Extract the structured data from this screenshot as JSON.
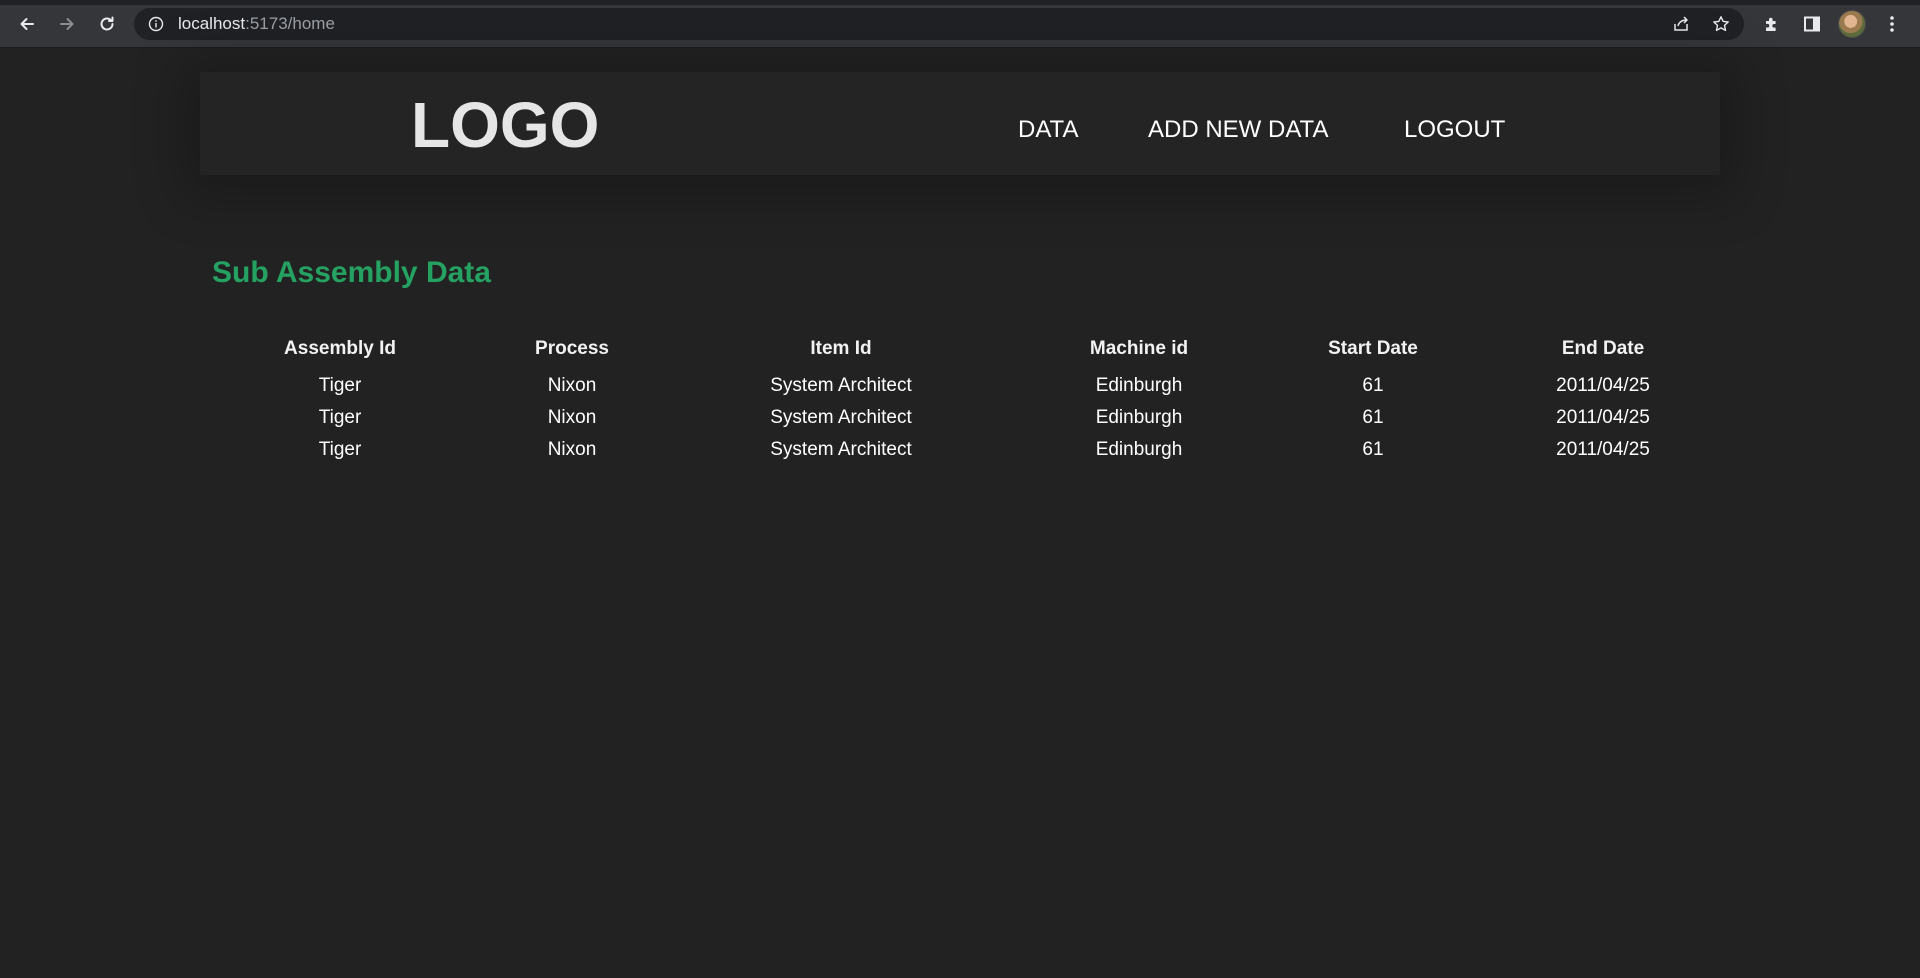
{
  "browser": {
    "url_host": "localhost",
    "url_rest": ":5173/home"
  },
  "header": {
    "logo": "LOGO",
    "nav": [
      {
        "label": "DATA"
      },
      {
        "label": "ADD NEW DATA"
      },
      {
        "label": "LOGOUT"
      }
    ]
  },
  "main": {
    "title": "Sub Assembly Data",
    "table": {
      "columns": [
        "Assembly Id",
        "Process",
        "Item Id",
        "Machine id",
        "Start Date",
        "End Date"
      ],
      "rows": [
        [
          "Tiger",
          "Nixon",
          "System Architect",
          "Edinburgh",
          "61",
          "2011/04/25"
        ],
        [
          "Tiger",
          "Nixon",
          "System Architect",
          "Edinburgh",
          "61",
          "2011/04/25"
        ],
        [
          "Tiger",
          "Nixon",
          "System Architect",
          "Edinburgh",
          "61",
          "2011/04/25"
        ]
      ]
    }
  },
  "colors": {
    "background": "#222222",
    "accent_title": "#25a262"
  }
}
